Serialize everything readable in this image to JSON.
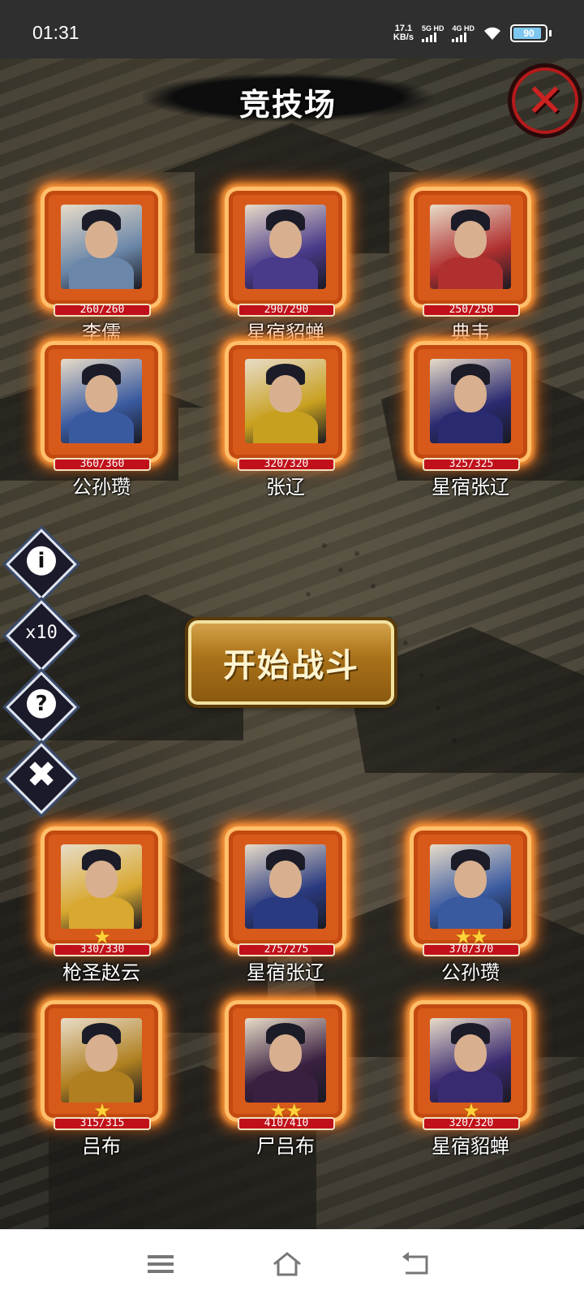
{
  "status_bar": {
    "time": "01:31",
    "net_speed_value": "17.1",
    "net_speed_unit": "KB/s",
    "sim1_label": "5G HD",
    "sim2_label": "4G HD",
    "battery": "90"
  },
  "game": {
    "title": "竞技场",
    "start_button": "开始战斗",
    "side_buttons": {
      "multiplier": "x10"
    },
    "enemy_heroes": [
      {
        "name": "李儒",
        "hp": "260/260",
        "stars": 0,
        "palette": "#6a86a8"
      },
      {
        "name": "星宿貂蝉",
        "hp": "290/290",
        "stars": 0,
        "palette": "#4a3a8a"
      },
      {
        "name": "典韦",
        "hp": "250/250",
        "stars": 0,
        "palette": "#b03030"
      },
      {
        "name": "公孙瓒",
        "hp": "360/360",
        "stars": 0,
        "palette": "#3a5aa0"
      },
      {
        "name": "张辽",
        "hp": "320/320",
        "stars": 0,
        "palette": "#c8a020"
      },
      {
        "name": "星宿张辽",
        "hp": "325/325",
        "stars": 0,
        "palette": "#2a2a70"
      }
    ],
    "player_heroes": [
      {
        "name": "枪圣赵云",
        "hp": "330/330",
        "stars": 1,
        "palette": "#d8a830"
      },
      {
        "name": "星宿张辽",
        "hp": "275/275",
        "stars": 0,
        "palette": "#2a3a80"
      },
      {
        "name": "公孙瓒",
        "hp": "370/370",
        "stars": 2,
        "palette": "#3a5aa0"
      },
      {
        "name": "吕布",
        "hp": "315/315",
        "stars": 1,
        "palette": "#b08020"
      },
      {
        "name": "尸吕布",
        "hp": "410/410",
        "stars": 2,
        "palette": "#3a2040"
      },
      {
        "name": "星宿貂蝉",
        "hp": "320/320",
        "stars": 1,
        "palette": "#3a2a70"
      }
    ]
  }
}
